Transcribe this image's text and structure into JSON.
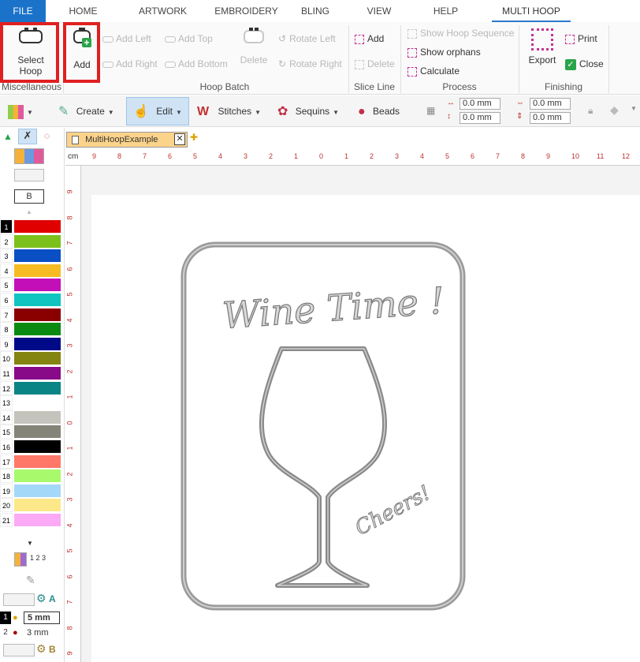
{
  "menu": {
    "tabs": [
      {
        "label": "FILE"
      },
      {
        "label": "HOME"
      },
      {
        "label": "ARTWORK"
      },
      {
        "label": "EMBROIDERY"
      },
      {
        "label": "BLING"
      },
      {
        "label": "VIEW"
      },
      {
        "label": "HELP"
      },
      {
        "label": "MULTI HOOP"
      }
    ],
    "active": "MULTI HOOP"
  },
  "ribbon": {
    "misc": {
      "select_hoop": "Select\nHoop",
      "group": "Miscellaneous"
    },
    "hoop_batch": {
      "add": "Add",
      "add_left": "Add Left",
      "add_right": "Add Right",
      "add_top": "Add Top",
      "add_bottom": "Add Bottom",
      "delete": "Delete",
      "rotate_left": "Rotate Left",
      "rotate_right": "Rotate Right",
      "group": "Hoop Batch"
    },
    "slice_line": {
      "add": "Add",
      "delete": "Delete",
      "group": "Slice Line"
    },
    "process": {
      "show_hoop_sequence": "Show Hoop Sequence",
      "show_orphans": "Show orphans",
      "calculate": "Calculate",
      "group": "Process"
    },
    "finishing": {
      "export": "Export",
      "print": "Print",
      "close": "Close",
      "group": "Finishing"
    }
  },
  "toolbar": {
    "create": "Create",
    "edit": "Edit",
    "stitches": "Stitches",
    "sequins": "Sequins",
    "beads": "Beads",
    "x_pos": "0.0 mm",
    "y_pos": "0.0 mm",
    "width": "0.0 mm",
    "height": "0.0 mm"
  },
  "left_panel": {
    "b_label": "B",
    "colors": [
      {
        "n": "1",
        "hex": "#e00000"
      },
      {
        "n": "2",
        "hex": "#7cc01c"
      },
      {
        "n": "3",
        "hex": "#0a4fc4"
      },
      {
        "n": "4",
        "hex": "#f6bc22"
      },
      {
        "n": "5",
        "hex": "#c20fb8"
      },
      {
        "n": "6",
        "hex": "#10c4c0"
      },
      {
        "n": "7",
        "hex": "#8a0000"
      },
      {
        "n": "8",
        "hex": "#0a8a10"
      },
      {
        "n": "9",
        "hex": "#000a88"
      },
      {
        "n": "10",
        "hex": "#848410"
      },
      {
        "n": "11",
        "hex": "#880a88"
      },
      {
        "n": "12",
        "hex": "#0a8484"
      },
      {
        "n": "13",
        "hex": "#ffffff"
      },
      {
        "n": "14",
        "hex": "#c4c4bc"
      },
      {
        "n": "15",
        "hex": "#848478"
      },
      {
        "n": "16",
        "hex": "#000000"
      },
      {
        "n": "17",
        "hex": "#ff7868"
      },
      {
        "n": "18",
        "hex": "#a8fa6c"
      },
      {
        "n": "19",
        "hex": "#a4d8f8"
      },
      {
        "n": "20",
        "hex": "#fce888"
      },
      {
        "n": "21",
        "hex": "#fcaaf6"
      }
    ],
    "seq_label": "1 2 3",
    "gear_a": "A",
    "gear_b": "B",
    "sequin_sizes": [
      {
        "n": "1",
        "size": "5 mm"
      },
      {
        "n": "2",
        "size": "3 mm"
      }
    ]
  },
  "document": {
    "tab_title": "MultiHoopExample"
  },
  "ruler": {
    "unit": "cm",
    "top_ticks": [
      "9",
      "8",
      "7",
      "6",
      "5",
      "4",
      "3",
      "2",
      "1",
      "0",
      "1",
      "2",
      "3",
      "4",
      "5",
      "6",
      "7",
      "8",
      "9",
      "10",
      "11",
      "12"
    ],
    "left_ticks": [
      "9",
      "8",
      "7",
      "6",
      "5",
      "4",
      "3",
      "2",
      "1",
      "0",
      "1",
      "2",
      "3",
      "4",
      "5",
      "6",
      "7",
      "8",
      "9"
    ]
  },
  "design": {
    "title_text": "Wine Time !",
    "glass_text": "Cheers!"
  }
}
